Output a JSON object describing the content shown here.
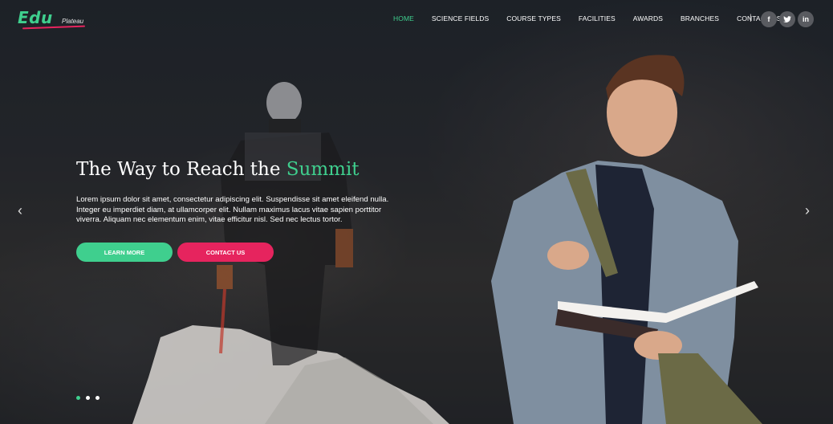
{
  "brand": {
    "logo_main": "Edu",
    "logo_sub": "Plateau"
  },
  "nav": {
    "items": [
      {
        "label": "HOME",
        "active": true
      },
      {
        "label": "SCIENCE FIELDS"
      },
      {
        "label": "COURSE TYPES"
      },
      {
        "label": "FACILITIES"
      },
      {
        "label": "AWARDS"
      },
      {
        "label": "BRANCHES"
      },
      {
        "label": "CONTACT US"
      }
    ],
    "separator": "|",
    "social": [
      {
        "icon": "facebook-icon",
        "glyph": "f"
      },
      {
        "icon": "twitter-icon",
        "glyph": "t"
      },
      {
        "icon": "linkedin-icon",
        "glyph": "in"
      }
    ]
  },
  "hero": {
    "headline_prefix": "The Way to Reach the ",
    "headline_accent": "Summit",
    "body": "Lorem ipsum dolor sit amet, consectetur adipiscing elit. Suspendisse sit amet eleifend nulla. Integer eu imperdiet diam, at ullamcorper elit. Nullam maximus lacus vitae sapien porttitor viverra. Aliquam nec elementum enim, vitae efficitur nisl. Sed nec lectus tortor.",
    "learn_more": "LEARN MORE",
    "contact_us": "CONTACT US",
    "prev_arrow": "‹",
    "next_arrow": "›"
  },
  "carousel": {
    "slide_count": 3,
    "active_index": 0
  },
  "colors": {
    "accent": "#3fcf8e",
    "accent_pink": "#e6245e"
  }
}
